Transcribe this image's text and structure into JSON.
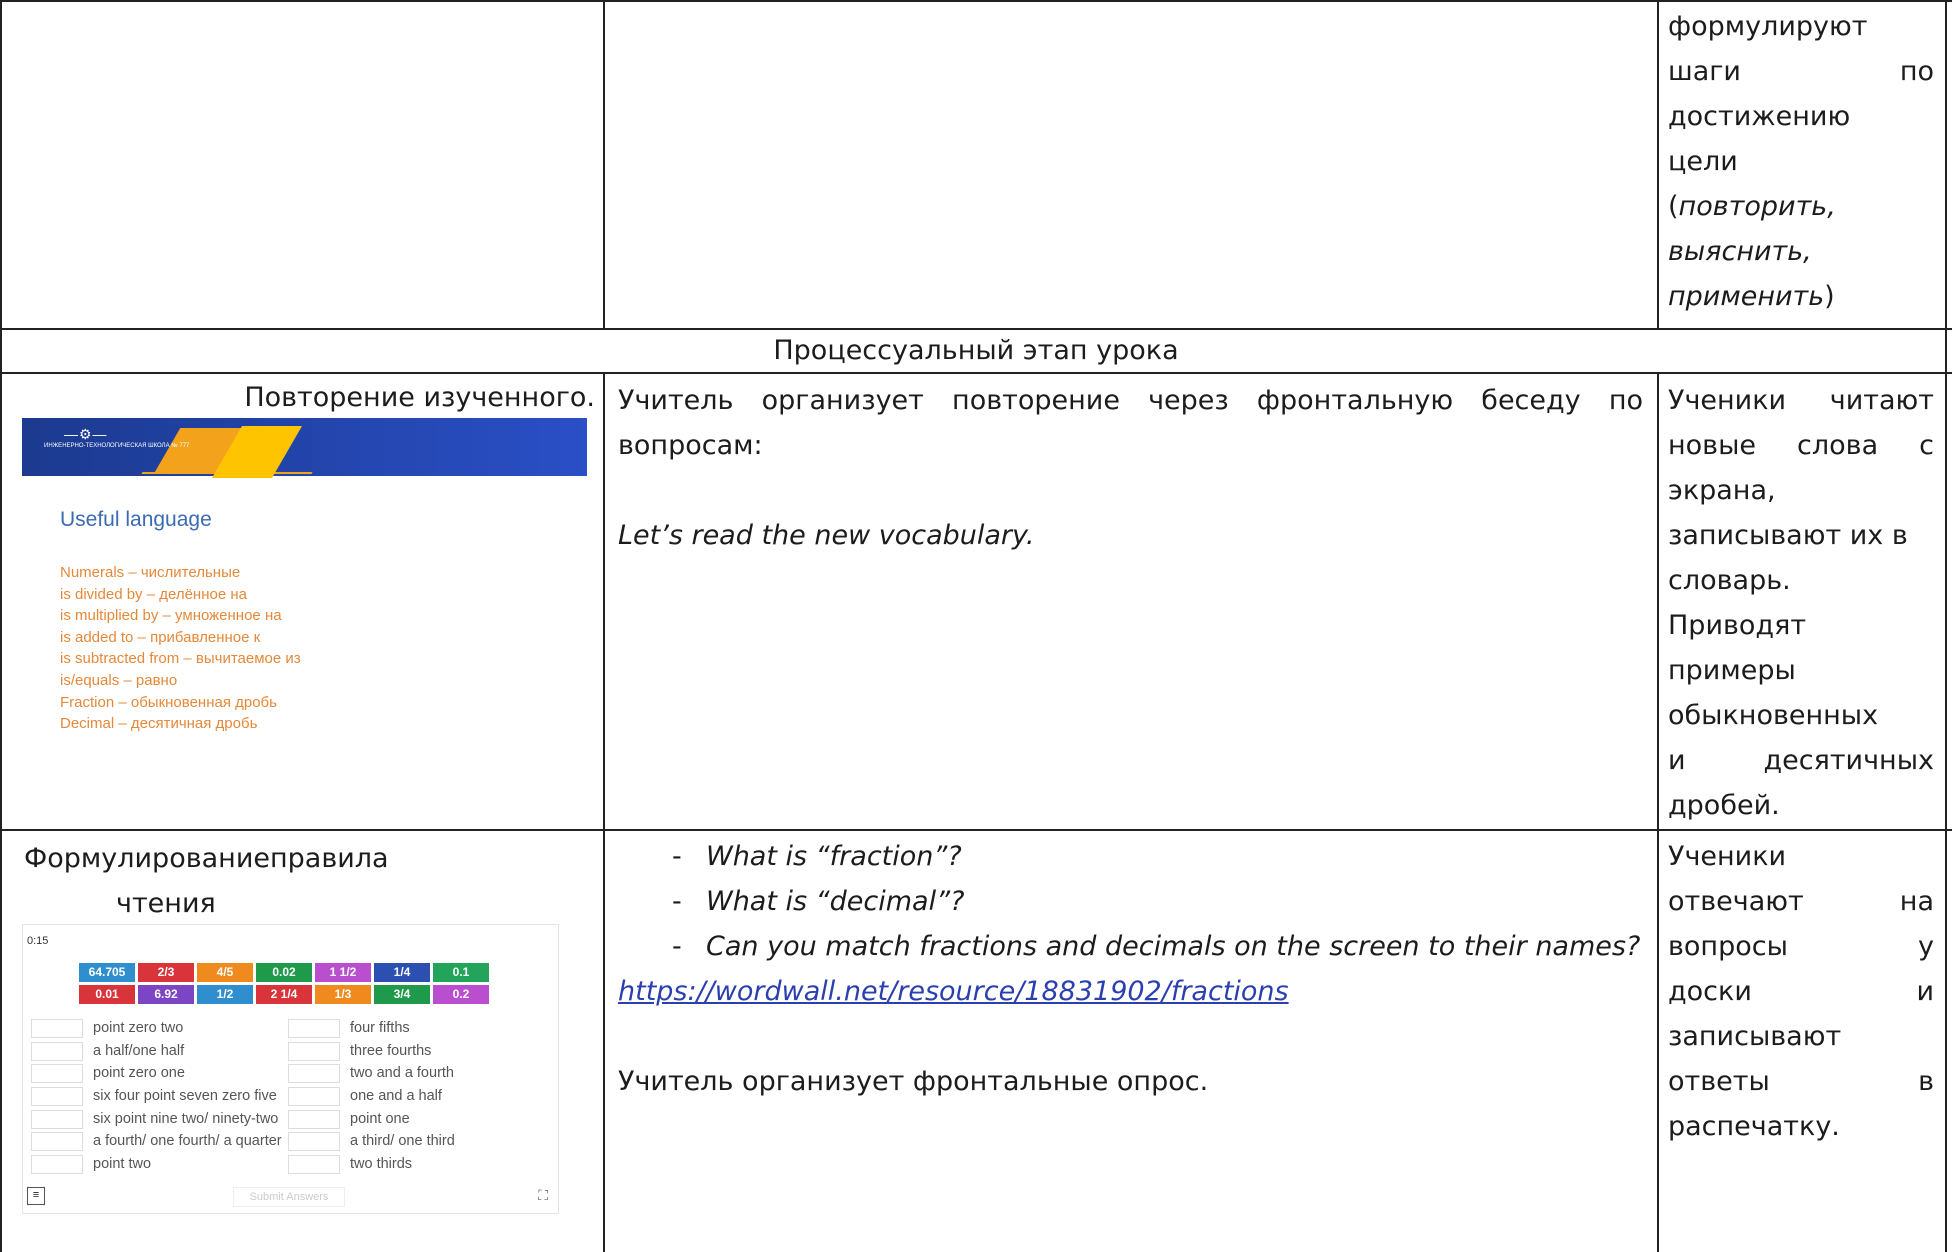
{
  "row1": {
    "col3_lines": [
      "формулируют",
      [
        "шаги",
        "по"
      ],
      "достижению",
      "цели"
    ],
    "col3_italic_open": "(",
    "col3_italic": [
      "повторить,",
      "выяснить,",
      "применить"
    ],
    "col3_italic_close": ")"
  },
  "section_header": "Процессуальный этап урока",
  "row2": {
    "col1_title": "Повторение изученного.",
    "slide": {
      "logo_text": "ИНЖЕНЕРНО-ТЕХНОЛОГИЧЕСКАЯ ШКОЛА № 777",
      "heading": "Useful language",
      "lines": [
        "Numerals – числительные",
        "is divided by – делённое на",
        "is multiplied by – умноженное на",
        "is added to – прибавленное к",
        "is subtracted from – вычитаемое из",
        "is/equals – равно",
        "Fraction – обыкновенная дробь",
        "Decimal – десятичная дробь"
      ]
    },
    "col2_line1": "Учитель организует повторение через фронтальную беседу по",
    "col2_line2": "вопросам:",
    "col2_italic": "Let’s read the new vocabulary.",
    "col3_lines": [
      [
        "Ученики",
        "читают"
      ],
      [
        "новые",
        "слова",
        "с"
      ],
      "экрана,",
      "записывают их в",
      "словарь.",
      "Приводят",
      "примеры",
      "обыкновенных",
      [
        "и",
        "десятичных"
      ],
      "дробей."
    ]
  },
  "row3": {
    "col1_title_a": "Формулирование",
    "col1_title_b": "правила",
    "col1_title_c": "чтения",
    "wordwall": {
      "timer": "0:15",
      "tiles_row1": [
        {
          "t": "64.705",
          "c": "#2f8fce"
        },
        {
          "t": "2/3",
          "c": "#d9343a"
        },
        {
          "t": "4/5",
          "c": "#ef8a1f"
        },
        {
          "t": "0.02",
          "c": "#1f9a4a"
        },
        {
          "t": "1 1/2",
          "c": "#b94fcf"
        },
        {
          "t": "1/4",
          "c": "#2c4fb2"
        },
        {
          "t": "0.1",
          "c": "#22a55a"
        }
      ],
      "tiles_row2": [
        {
          "t": "0.01",
          "c": "#d9343a"
        },
        {
          "t": "6.92",
          "c": "#7b45c4"
        },
        {
          "t": "1/2",
          "c": "#2f8fce"
        },
        {
          "t": "2 1/4",
          "c": "#d9343a"
        },
        {
          "t": "1/3",
          "c": "#ef8a1f"
        },
        {
          "t": "3/4",
          "c": "#1f9a4a"
        },
        {
          "t": "0.2",
          "c": "#b94fcf"
        }
      ],
      "left_items": [
        "point zero two",
        "a half/one half",
        "point zero one",
        "six four point seven zero five",
        "six point nine two/ ninety-two",
        "a fourth/ one fourth/ a quarter",
        "point two"
      ],
      "right_items": [
        "four fifths",
        "three fourths",
        "two and a fourth",
        "one and a half",
        "point one",
        "a third/ one third",
        "two thirds"
      ],
      "submit": "Submit Answers",
      "menu_icon": "≡",
      "expand_icon": "⛶"
    },
    "col2_bullets": [
      "What is “fraction”?",
      "What is “decimal”?",
      "Can you match fractions and decimals on the screen to their names?"
    ],
    "col2_link": "https://wordwall.net/resource/18831902/fractions",
    "col2_plain": "Учитель организует фронтальные опрос.",
    "col3_lines": [
      "Ученики",
      [
        "отвечают",
        "на"
      ],
      [
        "вопросы",
        "у"
      ],
      [
        "доски",
        "и"
      ],
      "записывают",
      [
        "ответы",
        "в"
      ],
      "распечатку."
    ]
  }
}
